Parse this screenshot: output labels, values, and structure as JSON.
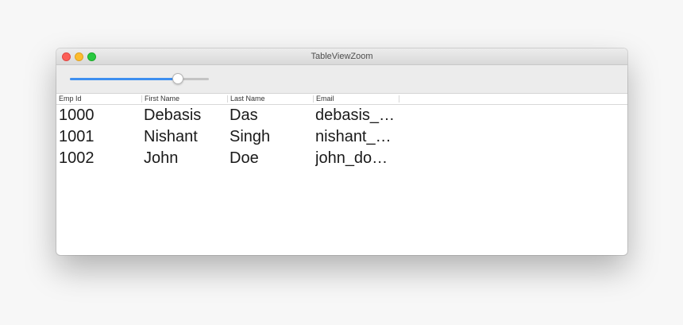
{
  "window": {
    "title": "TableViewZoom"
  },
  "slider": {
    "value": 0.8
  },
  "table": {
    "columns": [
      "Emp Id",
      "First Name",
      "Last Name",
      "Email"
    ],
    "rows": [
      [
        "1000",
        "Debasis",
        "Das",
        "debasis_…"
      ],
      [
        "1001",
        "Nishant",
        "Singh",
        "nishant_…"
      ],
      [
        "1002",
        "John",
        "Doe",
        "john_do…"
      ]
    ]
  }
}
